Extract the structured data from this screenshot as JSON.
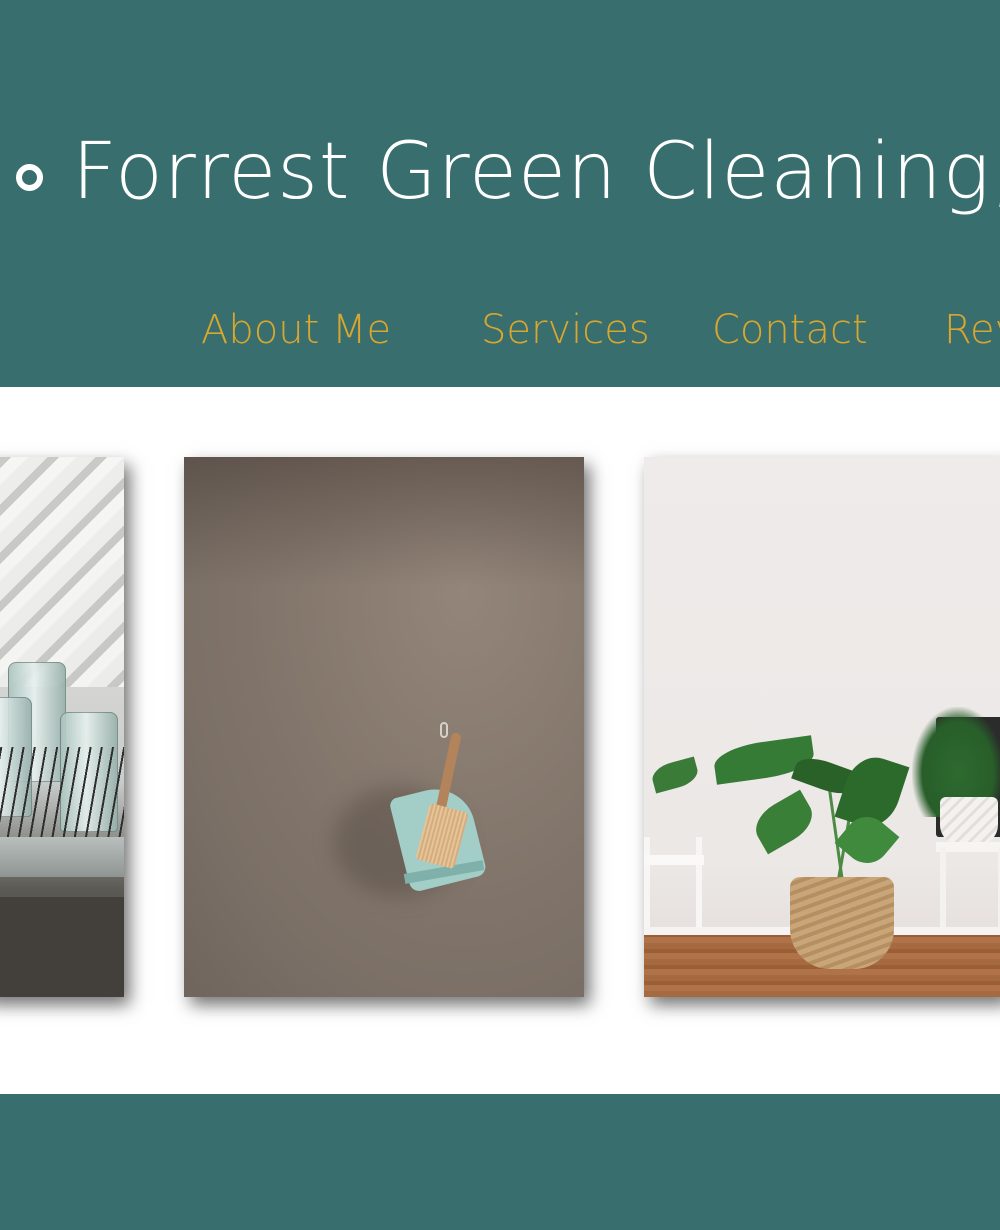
{
  "site": {
    "title": "Forrest Green Cleaning,"
  },
  "nav": {
    "items": [
      {
        "label": "About Me"
      },
      {
        "label": "Services"
      },
      {
        "label": "Contact"
      },
      {
        "label": "Rev"
      }
    ]
  },
  "colors": {
    "header_bg": "#386e6d",
    "nav_text": "#d9a62e",
    "title_text": "#ffffff"
  },
  "gallery": {
    "photos": [
      {
        "subject": "glasses on dish rack"
      },
      {
        "subject": "brush and dustpan hanging on wall"
      },
      {
        "subject": "potted plants with white chairs"
      }
    ]
  },
  "icons": {
    "title_bullet": "circle-outline-icon"
  }
}
